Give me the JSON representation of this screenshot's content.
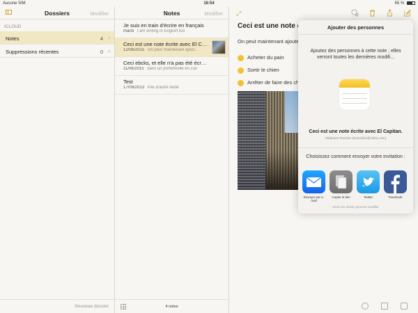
{
  "status": {
    "carrier": "Aucune SIM",
    "time": "16:54",
    "battery": "65 %"
  },
  "folders": {
    "title": "Dossiers",
    "edit": "Modifier",
    "section": "ICLOUD",
    "items": [
      {
        "label": "Notes",
        "count": "4",
        "selected": true
      },
      {
        "label": "Suppressions récentes",
        "count": "0",
        "selected": false
      }
    ],
    "new_folder": "Nouveau dossier"
  },
  "notes": {
    "title": "Notes",
    "edit": "Modifier",
    "items": [
      {
        "title": "Je suis en train d'écrire en français",
        "date": "mardi",
        "preview": "I am writing in English too"
      },
      {
        "title": "Ceci est une note écrite avec El Ca...",
        "date": "12/06/2015",
        "preview": "On peut maintenant ajout..."
      },
      {
        "title": "Ceci ebcks, et elle n'a pas été écrite avec...",
        "date": "11/06/2015",
        "preview": "dans un portefeuille en cuir"
      },
      {
        "title": "Test",
        "date": "17/09/2013",
        "preview": "Pas d'autre texte"
      }
    ],
    "count_label": "4 notes"
  },
  "detail": {
    "title": "Ceci est une note écrit",
    "text": "On peut maintenant ajoute",
    "checklist": [
      "Acheter du pain",
      "Sortir le chien",
      "Arrêter de faire des ch"
    ]
  },
  "popover": {
    "title": "Ajouter des personnes",
    "description": "Ajoutez des personnes à cette note ; elles verront toutes les dernières modifi...",
    "note_name": "Ceci est une note écrite avec El Capitan.",
    "owner": "Stéphane Ruscher (tesnclubic@clubic.com)",
    "choose": "Choisissez comment envoyer votre invitation :",
    "options": [
      {
        "label": "Envoyer par e-mail",
        "icon": "mail-icon"
      },
      {
        "label": "Copier le lien",
        "icon": "copy-link-icon"
      },
      {
        "label": "Twitter",
        "icon": "twitter-icon"
      },
      {
        "label": "Facebook",
        "icon": "facebook-icon"
      }
    ],
    "footer": "Seuls les invités peuvent modifier"
  },
  "colors": {
    "accent": "#c9a63a",
    "selected": "#f2e7c3",
    "checkbox": "#f0c232"
  }
}
